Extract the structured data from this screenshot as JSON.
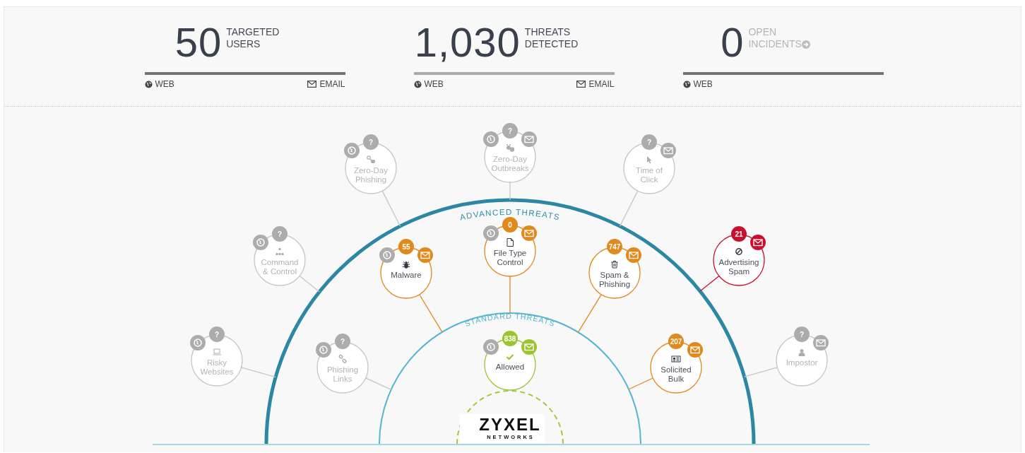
{
  "stats": [
    {
      "value": "50",
      "label": "TARGETED USERS",
      "muted": false,
      "link": false,
      "bar_active": true,
      "sources": [
        {
          "kind": "web",
          "label": "WEB"
        },
        {
          "kind": "email",
          "label": "EMAIL"
        }
      ]
    },
    {
      "value": "1,030",
      "label": "THREATS DETECTED",
      "muted": false,
      "link": false,
      "bar_active": false,
      "sources": [
        {
          "kind": "web",
          "label": "WEB"
        },
        {
          "kind": "email",
          "label": "EMAIL"
        }
      ]
    },
    {
      "value": "0",
      "label": "OPEN INCIDENTS",
      "muted": true,
      "link": true,
      "bar_active": true,
      "sources": [
        {
          "kind": "web",
          "label": "WEB"
        }
      ]
    }
  ],
  "rings": [
    {
      "label": "ADVANCED THREATS"
    },
    {
      "label": "STANDARD THREATS"
    }
  ],
  "nodes": [
    {
      "label_lines": [
        "Zero-Day",
        "Phishing"
      ],
      "active": false,
      "color": "#acacac",
      "count": "?",
      "web": true,
      "email": false
    },
    {
      "label_lines": [
        "Zero-Day",
        "Outbreaks"
      ],
      "active": false,
      "color": "#acacac",
      "count": "?",
      "web": true,
      "email": true
    },
    {
      "label_lines": [
        "Time of",
        "Click"
      ],
      "active": false,
      "color": "#acacac",
      "count": "?",
      "web": false,
      "email": true
    },
    {
      "label_lines": [
        "Command",
        "& Control"
      ],
      "active": false,
      "color": "#acacac",
      "count": "?",
      "web": true,
      "email": false
    },
    {
      "label_lines": [
        "Malware"
      ],
      "active": true,
      "color": "#e0891c",
      "count": "55",
      "web": true,
      "email": true
    },
    {
      "label_lines": [
        "File Type",
        "Control"
      ],
      "active": true,
      "color": "#e0891c",
      "count": "0",
      "web": true,
      "email": true
    },
    {
      "label_lines": [
        "Spam &",
        "Phishing"
      ],
      "active": true,
      "color": "#e0891c",
      "count": "747",
      "web": false,
      "email": true
    },
    {
      "label_lines": [
        "Advertising",
        "Spam"
      ],
      "active": true,
      "color": "#c8102e",
      "count": "21",
      "web": false,
      "email": true
    },
    {
      "label_lines": [
        "Risky",
        "Websites"
      ],
      "active": false,
      "color": "#acacac",
      "count": "?",
      "web": true,
      "email": false
    },
    {
      "label_lines": [
        "Phishing",
        "Links"
      ],
      "active": false,
      "color": "#acacac",
      "count": "?",
      "web": true,
      "email": false
    },
    {
      "label_lines": [
        "Allowed"
      ],
      "active": true,
      "color": "#9cc431",
      "count": "838",
      "web": true,
      "email": true
    },
    {
      "label_lines": [
        "Solicited",
        "Bulk"
      ],
      "active": true,
      "color": "#e0891c",
      "count": "207",
      "web": false,
      "email": true
    },
    {
      "label_lines": [
        "Impostor"
      ],
      "active": false,
      "color": "#acacac",
      "count": "?",
      "web": false,
      "email": true
    }
  ],
  "logo": {
    "name": "ZYXEL",
    "tagline": "NETWORKS"
  }
}
